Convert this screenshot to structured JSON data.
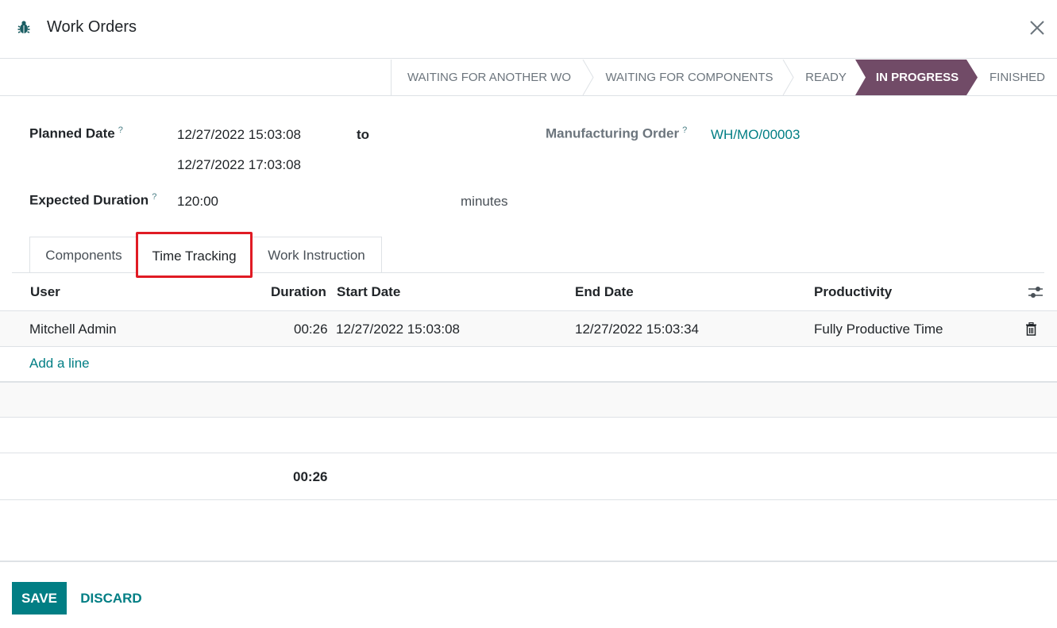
{
  "header": {
    "title": "Work Orders",
    "app_icon": "bug-icon",
    "close_icon": "close-icon"
  },
  "statusbar": {
    "stages": [
      {
        "label": "WAITING FOR ANOTHER WO",
        "active": false
      },
      {
        "label": "WAITING FOR COMPONENTS",
        "active": false
      },
      {
        "label": "READY",
        "active": false
      },
      {
        "label": "IN PROGRESS",
        "active": true
      },
      {
        "label": "FINISHED",
        "active": false
      }
    ],
    "active_color": "#714b67"
  },
  "form": {
    "planned_date_label": "Planned Date",
    "planned_date_help": "?",
    "planned_date_start": "12/27/2022 15:03:08",
    "to_label": "to",
    "planned_date_end": "12/27/2022 17:03:08",
    "mo_label": "Manufacturing Order",
    "mo_help": "?",
    "mo_value": "WH/MO/00003",
    "expected_duration_label": "Expected Duration",
    "expected_duration_help": "?",
    "expected_duration_value": "120:00",
    "expected_duration_unit": "minutes"
  },
  "tabs": [
    {
      "label": "Components",
      "active": false
    },
    {
      "label": "Time Tracking",
      "active": true
    },
    {
      "label": "Work Instruction",
      "active": false
    }
  ],
  "table": {
    "columns": [
      "User",
      "Duration",
      "Start Date",
      "End Date",
      "Productivity"
    ],
    "rows": [
      {
        "user": "Mitchell Admin",
        "duration": "00:26",
        "start": "12/27/2022 15:03:08",
        "end": "12/27/2022 15:03:34",
        "productivity": "Fully Productive Time"
      }
    ],
    "add_line": "Add a line",
    "total_duration": "00:26",
    "settings_icon": "sliders-icon",
    "row_delete_icon": "trash-icon"
  },
  "footer": {
    "save_label": "SAVE",
    "discard_label": "DISCARD"
  },
  "colors": {
    "brand": "#714b67",
    "primary": "#017e84",
    "highlight": "#e01b24"
  }
}
